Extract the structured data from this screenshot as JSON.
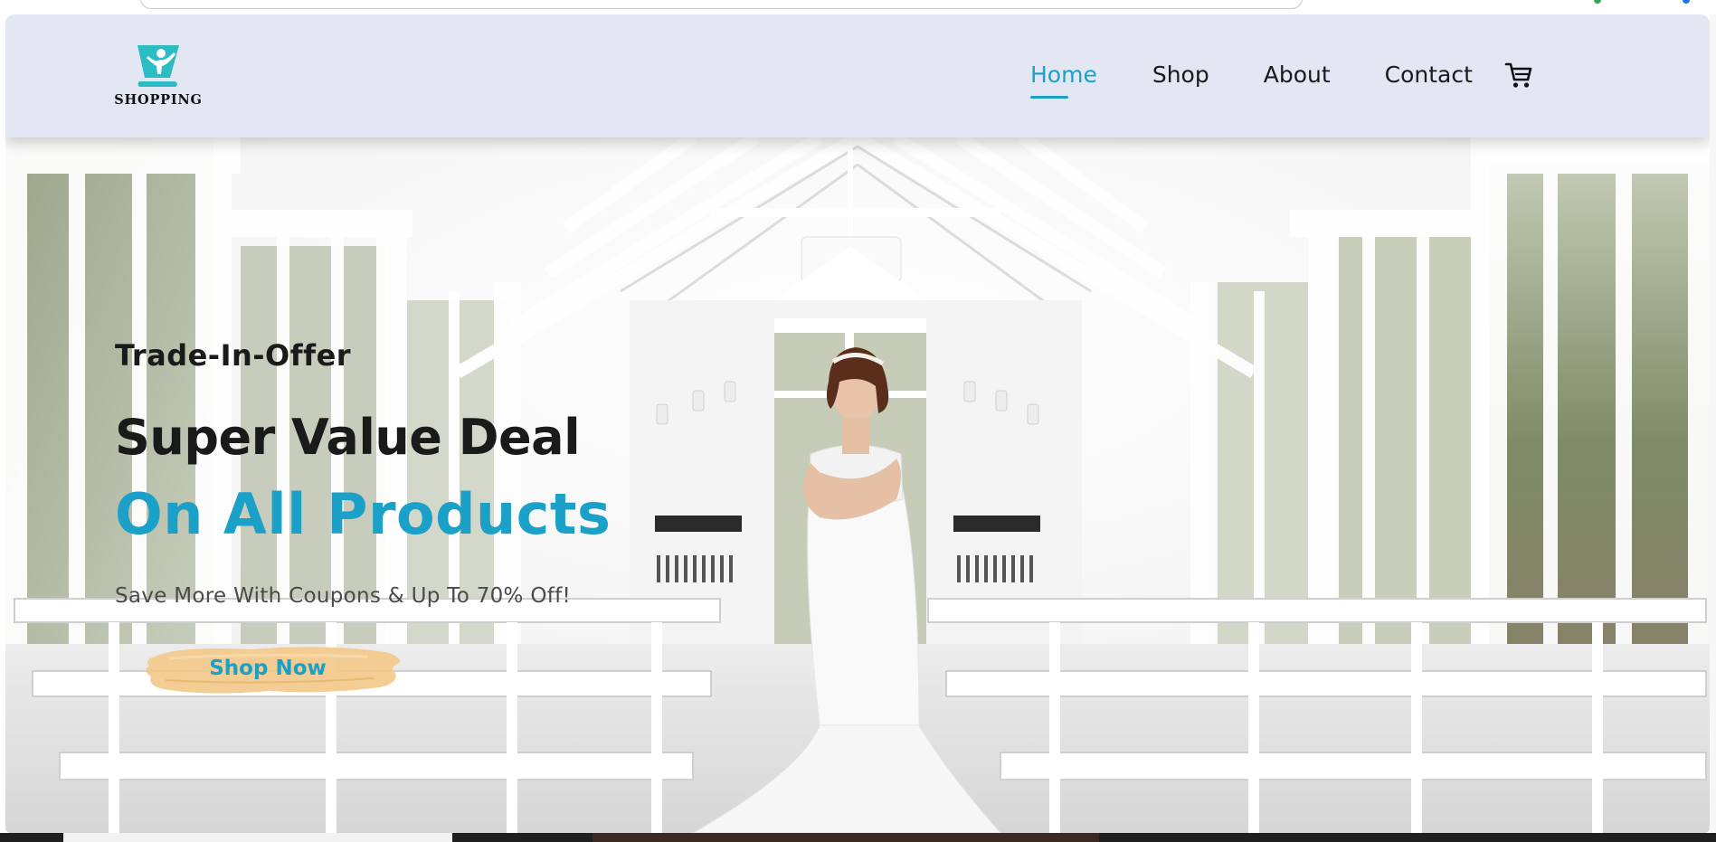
{
  "header": {
    "logo_text": "SHOPPING",
    "nav": {
      "home": "Home",
      "shop": "Shop",
      "about": "About",
      "contact": "Contact"
    },
    "cart_icon": "shopping-cart-icon"
  },
  "hero": {
    "offer_label": "Trade-In-Offer",
    "headline_1": "Super Value Deal",
    "headline_2": "On All Products",
    "subline": "Save More With Coupons & Up To 70% Off!",
    "button_label": "Shop Now"
  },
  "colors": {
    "accent": "#1ba0c8",
    "header_bg": "#e3e7f3",
    "button_brush": "#f2c98a",
    "text_dark": "#1a1a1a"
  }
}
